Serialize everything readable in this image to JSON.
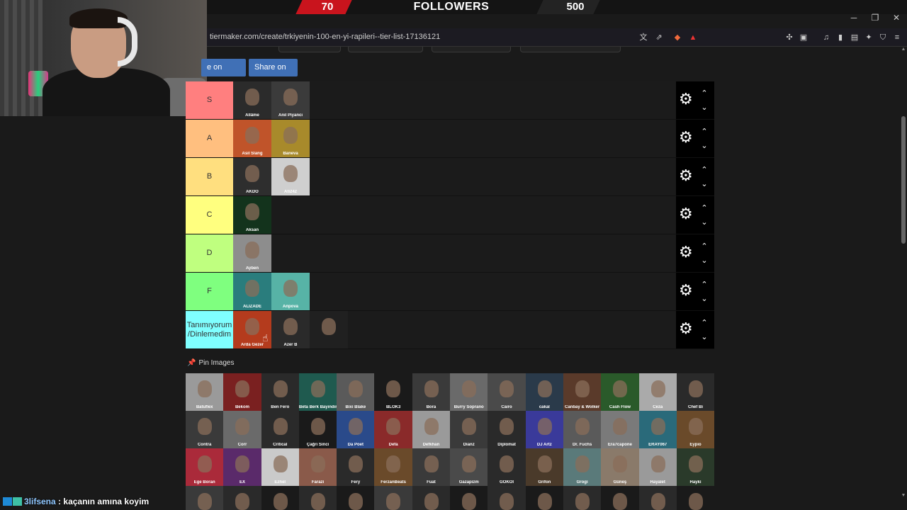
{
  "overlay": {
    "followers_current": "70",
    "followers_label": "FOLLOWERS",
    "followers_goal": "500"
  },
  "window": {
    "minimize": "─",
    "maximize": "❐",
    "close": "✕"
  },
  "browser": {
    "url": "tiermaker.com/create/trkiyenin-100-en-yi-rapileri--tier-list-17136121"
  },
  "page": {
    "share_twitter": "e on Twitter",
    "share_fb": "Share on FB",
    "pin_images": "Pin Images"
  },
  "tiers": [
    {
      "label": "S",
      "color": "#ff7f7f",
      "items": [
        {
          "name": "Allâme",
          "bg": "#2b2b2b"
        },
        {
          "name": "Anıl Piyancı",
          "bg": "#3b3b3b"
        }
      ]
    },
    {
      "label": "A",
      "color": "#ffbf7f",
      "items": [
        {
          "name": "Asil Slang",
          "bg": "#c0542a"
        },
        {
          "name": "Baneva",
          "bg": "#a88a2b"
        }
      ]
    },
    {
      "label": "B",
      "color": "#ffdf7f",
      "items": [
        {
          "name": "AKDO",
          "bg": "#2e2e2e"
        },
        {
          "name": "Ati242",
          "bg": "#cfcfcf"
        }
      ]
    },
    {
      "label": "C",
      "color": "#ffff7f",
      "items": [
        {
          "name": "Aksan",
          "bg": "#13331c"
        }
      ]
    },
    {
      "label": "D",
      "color": "#bfff7f",
      "items": [
        {
          "name": "Ayben",
          "bg": "#8d8d8d"
        }
      ]
    },
    {
      "label": "F",
      "color": "#7fff7f",
      "items": [
        {
          "name": "ALIZADE",
          "bg": "#2a7d7d"
        },
        {
          "name": "Anpova",
          "bg": "#57b3a6"
        }
      ]
    },
    {
      "label": "Tanımıyorum /Dinlemedim",
      "color": "#7fffff",
      "items": [
        {
          "name": "Arda Gezer",
          "bg": "#b43b1d"
        },
        {
          "name": "Azer B",
          "bg": "#2a2a2a"
        },
        {
          "name": "",
          "bg": "#202020"
        }
      ]
    }
  ],
  "pool": [
    {
      "name": "Batuflex",
      "bg": "#9a9a9a"
    },
    {
      "name": "Bekom",
      "bg": "#7a2020"
    },
    {
      "name": "Ben Fero",
      "bg": "#2a2a2a"
    },
    {
      "name": "Beta Berk Bayındır",
      "bg": "#1f5a4f"
    },
    {
      "name": "Bixi Blake",
      "bg": "#5a5a5a"
    },
    {
      "name": "BLOK3",
      "bg": "#1a1a1a"
    },
    {
      "name": "Bora",
      "bg": "#3a3a3a"
    },
    {
      "name": "Burry Soprano",
      "bg": "#6a6a6a"
    },
    {
      "name": "Cairo",
      "bg": "#4a4a4a"
    },
    {
      "name": "cakal",
      "bg": "#2a3a4a"
    },
    {
      "name": "Canbay & Wolker",
      "bg": "#5a3a2a"
    },
    {
      "name": "Cash Flow",
      "bg": "#2a5a2a"
    },
    {
      "name": "Ceza",
      "bg": "#aaaaaa"
    },
    {
      "name": "Chef Bi",
      "bg": "#2a2a2a"
    },
    {
      "name": "Contra",
      "bg": "#3a3a3a"
    },
    {
      "name": "Corr",
      "bg": "#6a6a6a"
    },
    {
      "name": "Critical",
      "bg": "#2a2a2a"
    },
    {
      "name": "Çağrı Sinci",
      "bg": "#1a1a1a"
    },
    {
      "name": "Da Poet",
      "bg": "#2a4a8a"
    },
    {
      "name": "Defa",
      "bg": "#8a2a2a"
    },
    {
      "name": "Defkhan",
      "bg": "#9a9a9a"
    },
    {
      "name": "Dianz",
      "bg": "#3a3a3a"
    },
    {
      "name": "Diplomat",
      "bg": "#2a2a2a"
    },
    {
      "name": "DJ Artz",
      "bg": "#3a3a9a"
    },
    {
      "name": "Dr. Fuchs",
      "bg": "#5a5a5a"
    },
    {
      "name": "Era7capone",
      "bg": "#7a7a7a"
    },
    {
      "name": "ERAY067",
      "bg": "#2a6a7a"
    },
    {
      "name": "Eypio",
      "bg": "#6a4a2a"
    },
    {
      "name": "Ege Boran",
      "bg": "#aa2a3a"
    },
    {
      "name": "EX",
      "bg": "#5a2a6a"
    },
    {
      "name": "Ezhel",
      "bg": "#cacaca"
    },
    {
      "name": "Farazi",
      "bg": "#8a5a4a"
    },
    {
      "name": "Fery",
      "bg": "#2a2a2a"
    },
    {
      "name": "FerzanBeats",
      "bg": "#6a4a2a"
    },
    {
      "name": "Fuat",
      "bg": "#3a3a3a"
    },
    {
      "name": "Gazapizm",
      "bg": "#4a4a4a"
    },
    {
      "name": "GOKOI",
      "bg": "#2a2a2a"
    },
    {
      "name": "Grifon",
      "bg": "#4a3a2a"
    },
    {
      "name": "Grogi",
      "bg": "#5a7a7a"
    },
    {
      "name": "Güneş",
      "bg": "#8a7a6a"
    },
    {
      "name": "Hayalet",
      "bg": "#9a9a9a"
    },
    {
      "name": "Hayki",
      "bg": "#2a3a2a"
    },
    {
      "name": "",
      "bg": "#3a3a3a"
    },
    {
      "name": "",
      "bg": "#2a2a2a"
    },
    {
      "name": "",
      "bg": "#1a1a1a"
    },
    {
      "name": "",
      "bg": "#2a2a2a"
    },
    {
      "name": "",
      "bg": "#1a1a1a"
    },
    {
      "name": "",
      "bg": "#3a3a3a"
    },
    {
      "name": "",
      "bg": "#2a2a2a"
    },
    {
      "name": "",
      "bg": "#1a1a1a"
    },
    {
      "name": "",
      "bg": "#2a2a2a"
    },
    {
      "name": "",
      "bg": "#1a1a1a"
    },
    {
      "name": "",
      "bg": "#2a2a2a"
    },
    {
      "name": "",
      "bg": "#1a1a1a"
    },
    {
      "name": "",
      "bg": "#2a2a2a"
    },
    {
      "name": "",
      "bg": "#1a1a1a"
    }
  ],
  "chat": {
    "user": "3lifsena",
    "separator": ":",
    "message": "kaçanın amına koyim"
  }
}
